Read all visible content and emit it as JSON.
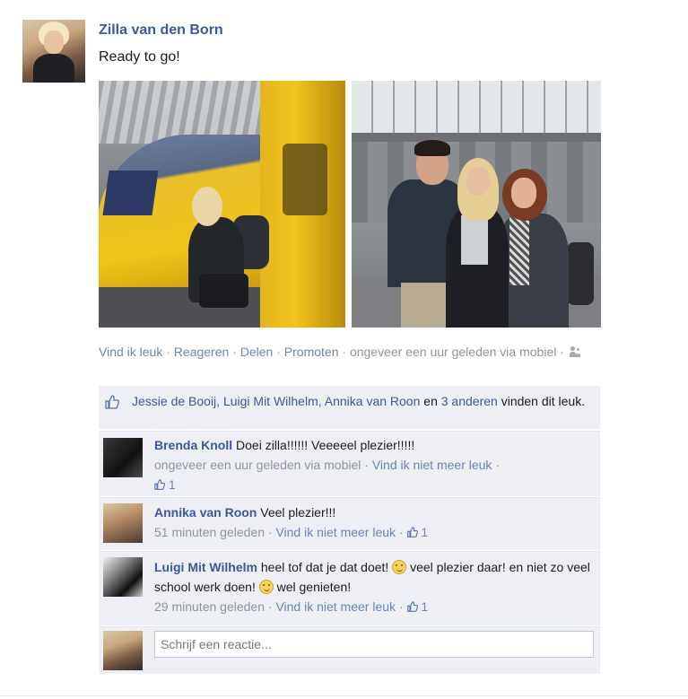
{
  "post": {
    "author": "Zilla van den Born",
    "message": "Ready to go!",
    "actions": {
      "like": "Vind ik leuk",
      "comment": "Reageren",
      "share": "Delen",
      "promote": "Promoten",
      "sep": "·",
      "time_prefix": "ongeveer een uur geleden via",
      "time_suffix": "mobiel",
      "privacy_icon": "friends-icon"
    }
  },
  "likes": {
    "names": "Jessie de Booij, Luigi Mit Wilhelm, Annika van Roon",
    "conj": "en",
    "others": "3 anderen",
    "suffix": "vinden dit leuk.",
    "icon": "thumbs-up-icon"
  },
  "comments": [
    {
      "author": "Brenda Knoll",
      "text": "Doei zilla!!!!!! Veeeeel plezier!!!!!",
      "time": "ongeveer een uur geleden via mobiel",
      "unlike": "Vind ik niet meer leuk",
      "likes": "1"
    },
    {
      "author": "Annika van Roon",
      "text": "Veel plezier!!!",
      "time": "51 minuten geleden",
      "unlike": "Vind ik niet meer leuk",
      "likes": "1"
    },
    {
      "author": "Luigi Mit Wilhelm",
      "text_1": "heel tof dat je dat doet!",
      "text_2": "veel plezier daar! en niet zo veel school werk doen!",
      "text_3": "wel genieten!",
      "time": "29 minuten geleden",
      "unlike": "Vind ik niet meer leuk",
      "likes": "1"
    }
  ],
  "reply": {
    "placeholder": "Schrijf een reactie..."
  },
  "colors": {
    "link": "#3b5998",
    "muted": "#90949c",
    "ufi_background": "#edeff4"
  }
}
